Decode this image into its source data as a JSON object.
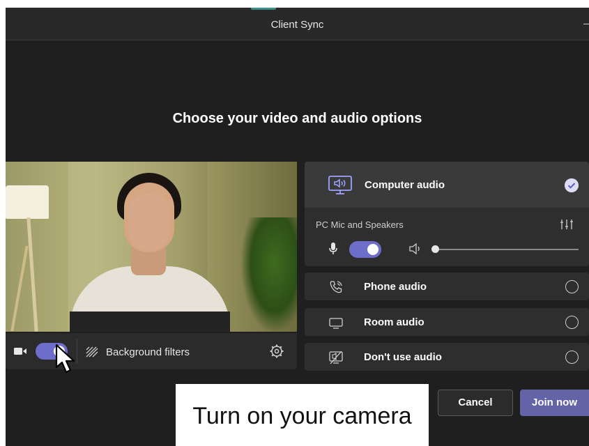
{
  "window": {
    "title": "Client Sync"
  },
  "heading": "Choose your video and audio options",
  "preview_controls": {
    "camera_icon": "video-camera-icon",
    "camera_on": true,
    "background_filters_icon": "background-blur-icon",
    "background_filters_label": "Background filters",
    "settings_icon": "gear-icon"
  },
  "audio": {
    "computer_audio": {
      "icon": "monitor-speaker-icon",
      "label": "Computer audio",
      "selected": true,
      "device_label": "PC Mic and Speakers",
      "mic_on": true,
      "volume_level": 0
    },
    "options": [
      {
        "icon": "phone-icon",
        "label": "Phone audio",
        "selected": false
      },
      {
        "icon": "room-display-icon",
        "label": "Room audio",
        "selected": false
      },
      {
        "icon": "no-audio-icon",
        "label": "Don't use audio",
        "selected": false
      }
    ]
  },
  "buttons": {
    "cancel": "Cancel",
    "join": "Join now"
  },
  "caption": "Turn on your camera",
  "colors": {
    "accent": "#6264a7",
    "toggle": "#6d6ec9",
    "background": "#1f1f1f"
  }
}
